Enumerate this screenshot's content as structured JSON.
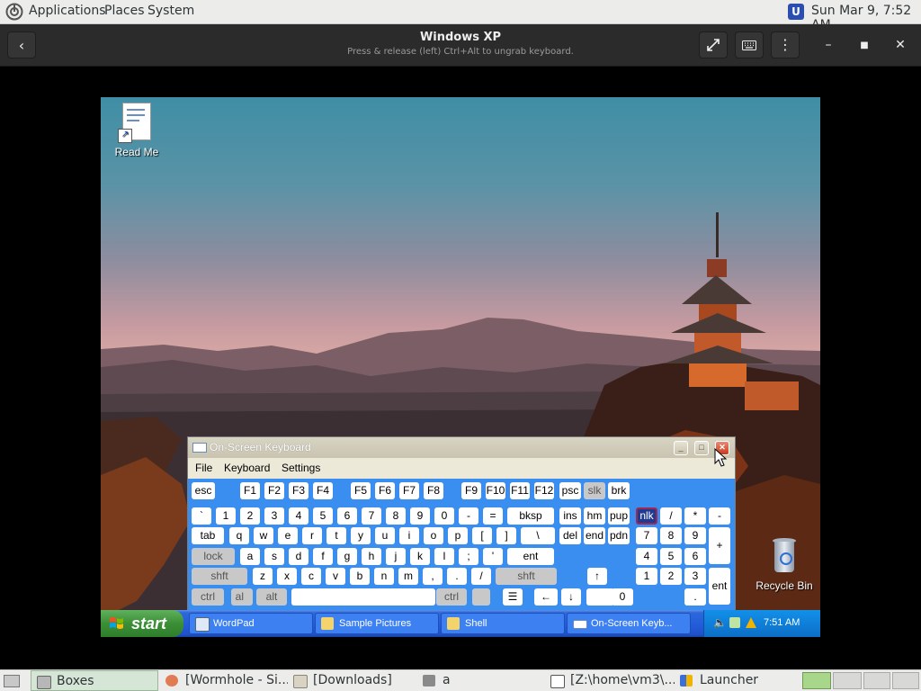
{
  "top_panel": {
    "menus": [
      "Applications",
      "Places",
      "System"
    ],
    "clock": "Sun Mar  9,  7:52 AM"
  },
  "header_bar": {
    "title": "Windows XP",
    "subtitle": "Press & release (left) Ctrl+Alt to ungrab keyboard."
  },
  "desktop": {
    "icons": [
      {
        "label": "Read Me",
        "icon": "document-shortcut-icon"
      },
      {
        "label": "Recycle Bin",
        "icon": "recycle-bin-icon"
      }
    ]
  },
  "osk": {
    "title": "On-Screen Keyboard",
    "menu": [
      "File",
      "Keyboard",
      "Settings"
    ],
    "rows": {
      "fn": [
        "esc",
        "F1",
        "F2",
        "F3",
        "F4",
        "F5",
        "F6",
        "F7",
        "F8",
        "F9",
        "F10",
        "F11",
        "F12",
        "psc",
        "slk",
        "brk"
      ],
      "num": [
        "`",
        "1",
        "2",
        "3",
        "4",
        "5",
        "6",
        "7",
        "8",
        "9",
        "0",
        "-",
        "=",
        "bksp",
        "ins",
        "hm",
        "pup",
        "nlk",
        "/",
        "*",
        "-"
      ],
      "top": [
        "tab",
        "q",
        "w",
        "e",
        "r",
        "t",
        "y",
        "u",
        "i",
        "o",
        "p",
        "[",
        "]",
        "\\",
        "del",
        "end",
        "pdn",
        "7",
        "8",
        "9",
        "+"
      ],
      "home": [
        "lock",
        "a",
        "s",
        "d",
        "f",
        "g",
        "h",
        "j",
        "k",
        "l",
        ";",
        "'",
        "ent",
        "4",
        "5",
        "6"
      ],
      "shift": [
        "shft",
        "z",
        "x",
        "c",
        "v",
        "b",
        "n",
        "m",
        ",",
        ".",
        "/",
        "shft",
        "↑",
        "1",
        "2",
        "3",
        "ent"
      ],
      "bottom": [
        "ctrl",
        "alt",
        "alt",
        "ctrl",
        "←",
        "↓",
        "→",
        "0",
        "."
      ]
    }
  },
  "xp_taskbar": {
    "start_label": "start",
    "items": [
      "WordPad",
      "Sample Pictures",
      "Shell",
      "On-Screen Keyb..."
    ],
    "clock": "7:51 AM"
  },
  "bottom_panel": {
    "items": [
      "Boxes",
      "[Wormhole - Si...",
      "[Downloads]",
      "a",
      "[Z:\\home\\vm3\\...",
      "Launcher"
    ]
  },
  "colors": {
    "panel_bg": "#ececeb",
    "header_bg": "#2b2b2b",
    "osk_key_area": "#3a8eef",
    "xp_taskbar": "#245edb",
    "xp_start_green": "#3b8f36"
  }
}
